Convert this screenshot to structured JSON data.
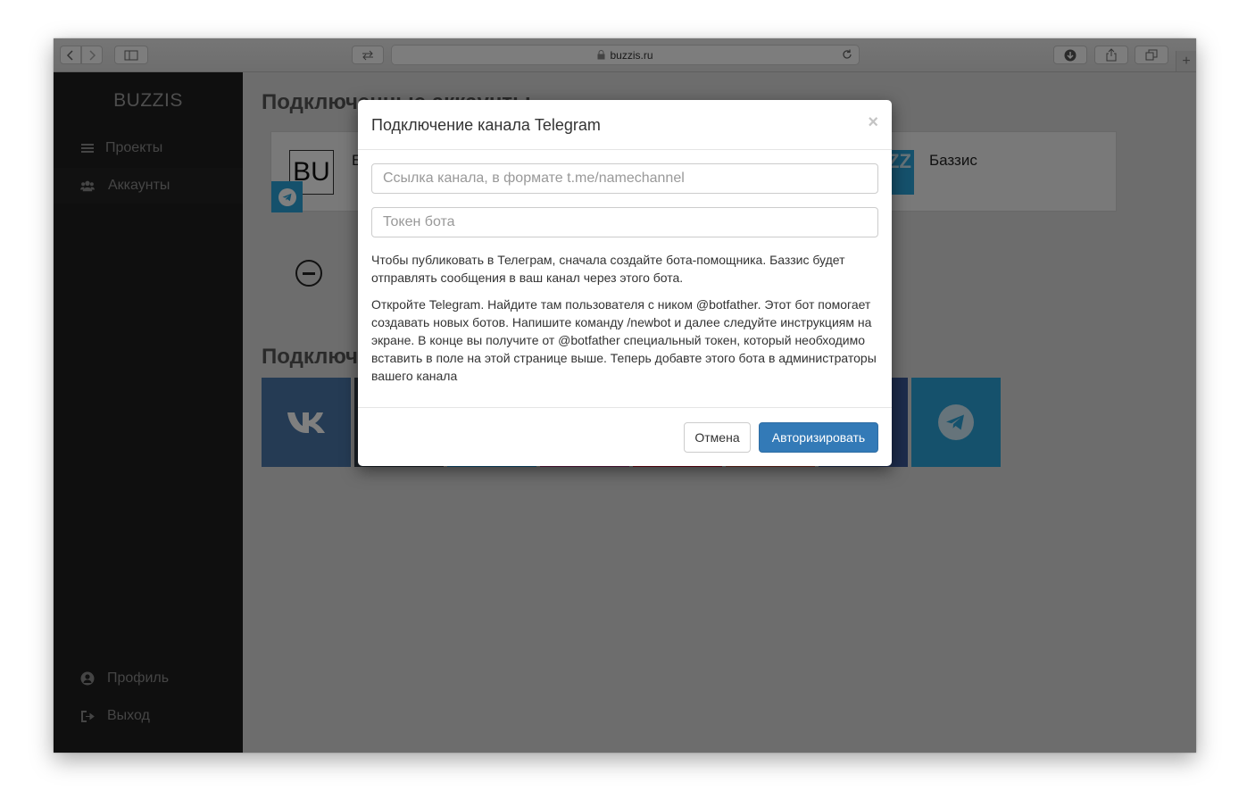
{
  "browser": {
    "url": "buzzis.ru"
  },
  "sidebar": {
    "brand": "BUZZIS",
    "items": [
      {
        "label": "Проекты",
        "icon": "list-icon"
      },
      {
        "label": "Аккаунты",
        "icon": "users-icon"
      }
    ],
    "bottom_items": [
      {
        "label": "Профиль",
        "icon": "user-circle-icon"
      },
      {
        "label": "Выход",
        "icon": "sign-out-icon"
      }
    ]
  },
  "main": {
    "connected_heading": "Подключенные аккаунты",
    "connect_heading": "Подключить",
    "card": {
      "avatar_text": "BU",
      "name_initial": "Б",
      "logo_text": "ZZ",
      "name": "Баззис"
    },
    "colors": {
      "vk": "#4a76a8",
      "telegram": "#2aa3d8"
    }
  },
  "modal": {
    "title": "Подключение канала Telegram",
    "close": "×",
    "channel_placeholder": "Ссылка канала, в формате t.me/namechannel",
    "token_placeholder": "Токен бота",
    "help1": "Чтобы публиковать в Телеграм, сначала создайте бота-помощника. Баззис будет отправлять сообщения в ваш канал через этого бота.",
    "help2": "Откройте Telegram. Найдите там пользователя с ником @botfather. Этот бот помогает создавать новых ботов. Напишите команду /newbot и далее следуйте инструкциям на экране. В конце вы получите от @botfather специальный токен, который необходимо вставить в поле на этой странице выше. Теперь добавте этого бота в администраторы вашего канала",
    "cancel": "Отмена",
    "authorize": "Авторизировать"
  }
}
